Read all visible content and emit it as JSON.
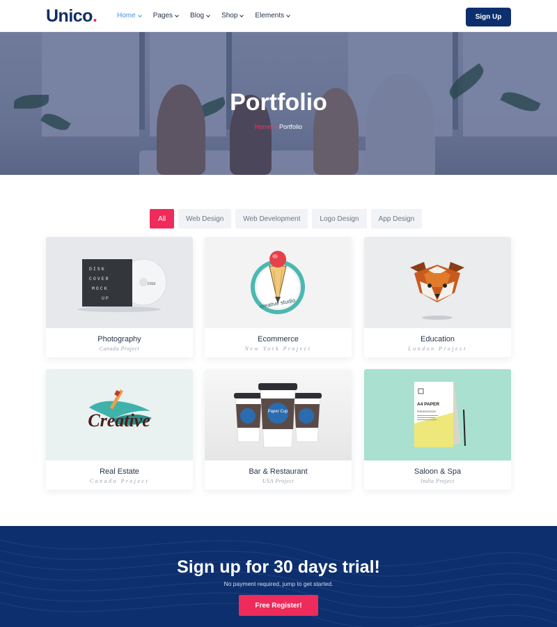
{
  "header": {
    "logo": "Unico",
    "logo_dot": ".",
    "nav": [
      {
        "label": "Home",
        "active": true
      },
      {
        "label": "Pages",
        "active": false
      },
      {
        "label": "Blog",
        "active": false
      },
      {
        "label": "Shop",
        "active": false
      },
      {
        "label": "Elements",
        "active": false
      }
    ],
    "signup_label": "Sign Up"
  },
  "hero": {
    "title": "Portfolio",
    "breadcrumb_home": "Home",
    "breadcrumb_current": "Portfolio"
  },
  "filters": [
    "All",
    "Web Design",
    "Web Development",
    "Logo Design",
    "App Design"
  ],
  "portfolio": [
    {
      "title": "Photography",
      "subtitle": "Canada Project"
    },
    {
      "title": "Ecommerce",
      "subtitle": "New York Project"
    },
    {
      "title": "Education",
      "subtitle": "London Project"
    },
    {
      "title": "Real Estate",
      "subtitle": "Canada Project"
    },
    {
      "title": "Bar & Restaurant",
      "subtitle": "USA Project"
    },
    {
      "title": "Saloon & Spa",
      "subtitle": "India Project"
    }
  ],
  "thumb_text": {
    "disk_lines": [
      "DISK",
      "COVER",
      "MOCK",
      "UP"
    ],
    "disk_label": "DISK",
    "creative_studio": "creative studio",
    "creative": "Creative",
    "paper_cup": "Paper Cup",
    "a4_paper": "A4 PAPER",
    "presentation": "PRESENTATION"
  },
  "cta": {
    "title": "Sign up for 30 days trial!",
    "subtitle": "No payment required, jump to get started.",
    "button": "Free Register!"
  },
  "colors": {
    "brand_navy": "#0d2f6e",
    "accent_pink": "#ee2b5b",
    "nav_active": "#4a8fe0"
  }
}
